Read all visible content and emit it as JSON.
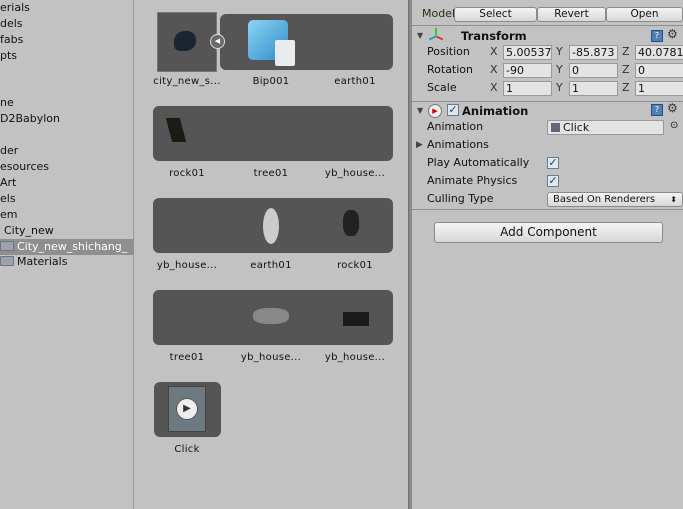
{
  "project_tree": [
    {
      "label": "erials"
    },
    {
      "label": "dels"
    },
    {
      "label": "fabs"
    },
    {
      "label": "pts"
    },
    {
      "label": ""
    },
    {
      "label": ""
    },
    {
      "label": "ne"
    },
    {
      "label": "D2Babylon"
    },
    {
      "label": ""
    },
    {
      "label": "der"
    },
    {
      "label": "esources"
    },
    {
      "label": "Art"
    },
    {
      "label": "els"
    },
    {
      "label": "em"
    },
    {
      "label": "City_new"
    },
    {
      "label": "City_new_shichang_",
      "selected": true,
      "icon": "folder-icon"
    },
    {
      "label": "Materials",
      "icon": "folder-icon"
    }
  ],
  "assets": {
    "row1": [
      "city_new_s...",
      "Bip001",
      "earth01"
    ],
    "row2": [
      "rock01",
      "tree01",
      "yb_house..."
    ],
    "row3": [
      "yb_house...",
      "earth01",
      "rock01"
    ],
    "row4": [
      "tree01",
      "yb_house...",
      "yb_house..."
    ],
    "row5": [
      "Click"
    ]
  },
  "inspector": {
    "model_label": "Model",
    "buttons": {
      "select": "Select",
      "revert": "Revert",
      "open": "Open"
    },
    "transform": {
      "title": "Transform",
      "position": {
        "label": "Position",
        "x": "5.00537",
        "y": "-85.873",
        "z": "40.0781"
      },
      "rotation": {
        "label": "Rotation",
        "x": "-90",
        "y": "0",
        "z": "0"
      },
      "scale": {
        "label": "Scale",
        "x": "1",
        "y": "1",
        "z": "1"
      }
    },
    "animation": {
      "title": "Animation",
      "enabled": true,
      "animation_label": "Animation",
      "animation_value": "Click",
      "animations_label": "Animations",
      "play_auto_label": "Play Automatically",
      "play_auto": true,
      "animate_physics_label": "Animate Physics",
      "animate_physics": true,
      "culling_label": "Culling Type",
      "culling_value": "Based On Renderers"
    },
    "add_component": "Add Component",
    "axes": {
      "x": "X",
      "y": "Y",
      "z": "Z"
    },
    "help": "?",
    "check": "✓"
  }
}
